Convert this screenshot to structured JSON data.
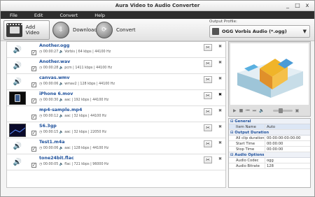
{
  "window": {
    "title": "Aura Video to Audio Converter",
    "controls": [
      "_",
      "□",
      "x"
    ]
  },
  "menu": [
    "File",
    "Edit",
    "Convert",
    "Help"
  ],
  "toolbar": {
    "add_video": "Add Video",
    "download": "Download",
    "convert": "Convert"
  },
  "output_profile": {
    "label": "Output Profile:",
    "value": "OGG Vorbis Audio (*.ogg)"
  },
  "files": [
    {
      "name": "Another.ogg",
      "duration": "00:00:27",
      "info": "Vorbis | 64 kbps | 44100 Hz",
      "type": "audio"
    },
    {
      "name": "Another.wav",
      "duration": "00:00:28",
      "info": "pcm | 1411 kbps | 44100 Hz",
      "type": "audio"
    },
    {
      "name": "canvas.wmv",
      "duration": "00:00:06",
      "info": "wmav2 | 128 kbps | 44100 Hz",
      "type": "audio"
    },
    {
      "name": "iPhone 6.mov",
      "duration": "00:00:30",
      "info": "aac | 192 kbps | 44100 Hz",
      "type": "video",
      "selected": true
    },
    {
      "name": "mp4-sample.mp4",
      "duration": "00:00:12",
      "info": "aac | 32 kbps | 44100 Hz",
      "type": "blank"
    },
    {
      "name": "S6.3gp",
      "duration": "00:00:15",
      "info": "aac | 32 kbps | 22050 Hz",
      "type": "video"
    },
    {
      "name": "Test1.m4a",
      "duration": "00:00:06",
      "info": "aac | 128 kbps | 44100 Hz",
      "type": "audio"
    },
    {
      "name": "tone24bit.flac",
      "duration": "00:00:05",
      "info": "flac | 721 kbps | 96000 Hz",
      "type": "audio"
    }
  ],
  "properties": [
    {
      "section": "General",
      "rows": [
        {
          "k": "Item Name",
          "v": "Auto"
        }
      ]
    },
    {
      "section": "Output Duration",
      "rows": [
        {
          "k": "All clip duration",
          "v": "00:00:00-00:00:00"
        },
        {
          "k": "Start Time",
          "v": "00:00:00"
        },
        {
          "k": "Stop Time",
          "v": "00:00:00"
        }
      ]
    },
    {
      "section": "Audio Options",
      "rows": [
        {
          "k": "Audio Codec",
          "v": "ogg"
        },
        {
          "k": "Audio Bitrate",
          "v": "128"
        }
      ]
    }
  ]
}
